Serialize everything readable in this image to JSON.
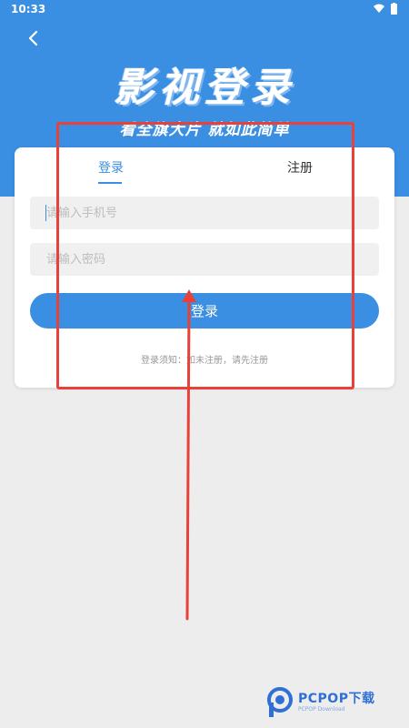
{
  "status_bar": {
    "time": "10:33",
    "wifi_icon": "wifi-icon",
    "battery_icon": "battery-icon"
  },
  "header": {
    "title": "影视登录",
    "subtitle": "看全旗大片 就如此简单"
  },
  "tabs": [
    {
      "label": "登录",
      "active": true
    },
    {
      "label": "注册",
      "active": false
    }
  ],
  "form": {
    "phone_placeholder": "请输入手机号",
    "password_placeholder": "请输入密码",
    "login_label": "登录",
    "notice": "登录须知：如未注册，请先注册"
  },
  "watermark": {
    "brand": "PCPOP下载",
    "sub": "PCPOP Download"
  },
  "colors": {
    "primary": "#3b8fe3",
    "background": "#ededed",
    "annotation": "#e8413a"
  }
}
